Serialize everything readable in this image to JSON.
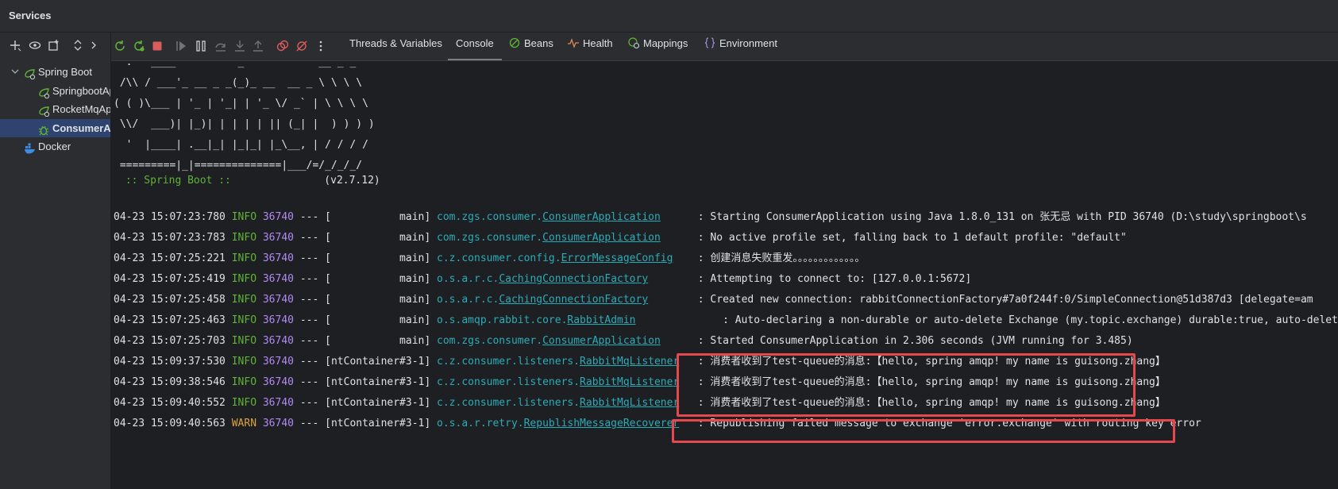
{
  "window": {
    "title": "Services"
  },
  "left_toolbar": {
    "icons": [
      "add-icon",
      "eye-icon",
      "new-window-icon",
      "expand-collapse-icon",
      "chevron-right-icon"
    ]
  },
  "tree": {
    "root": {
      "label": "Spring Boot",
      "icon": "spring-boot-icon"
    },
    "apps": [
      {
        "label": "SpringbootApplication",
        "icon": "spring-app-icon",
        "selected": false
      },
      {
        "label": "RocketMqApplication",
        "icon": "spring-app-icon",
        "selected": false
      },
      {
        "label": "ConsumerApplication",
        "icon": "debug-bug-icon",
        "selected": true
      }
    ],
    "docker": {
      "label": "Docker",
      "icon": "docker-icon"
    }
  },
  "run_toolbar": {
    "icons": [
      "rerun-icon",
      "rerun-debug-icon",
      "stop-icon",
      "resume-icon",
      "pause-icon",
      "step-over-icon",
      "step-into-icon",
      "step-out-icon",
      "view-breakpoints-icon",
      "mute-breakpoints-icon",
      "more-icon"
    ]
  },
  "tabs": [
    {
      "label": "Threads & Variables",
      "icon": "",
      "active": false
    },
    {
      "label": "Console",
      "icon": "",
      "active": true
    },
    {
      "label": "Beans",
      "icon": "beans-icon",
      "active": false
    },
    {
      "label": "Health",
      "icon": "health-icon",
      "active": false
    },
    {
      "label": "Mappings",
      "icon": "mappings-icon",
      "active": false
    },
    {
      "label": "Environment",
      "icon": "environment-icon",
      "active": false
    }
  ],
  "console": {
    "banner_lines": [
      "  .   ____          _            __ _ _",
      " /\\\\ / ___'_ __ _ _(_)_ __  __ _ \\ \\ \\ \\",
      "( ( )\\___ | '_ | '_| | '_ \\/ _` | \\ \\ \\ \\",
      " \\\\/  ___)| |_)| | | | | || (_| |  ) ) ) )",
      "  '  |____| .__|_| |_|_| |_\\__, | / / / /",
      " =========|_|==============|___/=/_/_/_/"
    ],
    "spring_boot_label": " :: Spring Boot :: ",
    "spring_boot_version": "              (v2.7.12)",
    "log_rows": [
      {
        "ts": "04-23 15:07:23:780",
        "level": "INFO",
        "pid": "36740",
        "sep": "---",
        "thread": "[           main]",
        "pkg": "com.zgs.consumer.",
        "cls": "ConsumerApplication",
        "pad": "     ",
        "msg": ": Starting ConsumerApplication using Java 1.8.0_131 on 张无忌 with PID 36740 (D:\\study\\springboot\\s"
      },
      {
        "ts": "04-23 15:07:23:783",
        "level": "INFO",
        "pid": "36740",
        "sep": "---",
        "thread": "[           main]",
        "pkg": "com.zgs.consumer.",
        "cls": "ConsumerApplication",
        "pad": "     ",
        "msg": ": No active profile set, falling back to 1 default profile: \"default\""
      },
      {
        "ts": "04-23 15:07:25:221",
        "level": "INFO",
        "pid": "36740",
        "sep": "---",
        "thread": "[           main]",
        "pkg": "c.z.consumer.config.",
        "cls": "ErrorMessageConfig",
        "pad": "   ",
        "msg": ": 创建消息失败重发。。。。。。。。。。。。。"
      },
      {
        "ts": "04-23 15:07:25:419",
        "level": "INFO",
        "pid": "36740",
        "sep": "---",
        "thread": "[           main]",
        "pkg": "o.s.a.r.c.",
        "cls": "CachingConnectionFactory",
        "pad": "       ",
        "msg": ": Attempting to connect to: [127.0.0.1:5672]"
      },
      {
        "ts": "04-23 15:07:25:458",
        "level": "INFO",
        "pid": "36740",
        "sep": "---",
        "thread": "[           main]",
        "pkg": "o.s.a.r.c.",
        "cls": "CachingConnectionFactory",
        "pad": "       ",
        "msg": ": Created new connection: rabbitConnectionFactory#7a0f244f:0/SimpleConnection@51d387d3 [delegate=am"
      },
      {
        "ts": "04-23 15:07:25:463",
        "level": "INFO",
        "pid": "36740",
        "sep": "---",
        "thread": "[           main]",
        "pkg": "o.s.amqp.rabbit.core.",
        "cls": "RabbitAdmin",
        "pad": "             ",
        "msg": ": Auto-declaring a non-durable or auto-delete Exchange (my.topic.exchange) durable:true, auto-delete"
      },
      {
        "ts": "04-23 15:07:25:703",
        "level": "INFO",
        "pid": "36740",
        "sep": "---",
        "thread": "[           main]",
        "pkg": "com.zgs.consumer.",
        "cls": "ConsumerApplication",
        "pad": "     ",
        "msg": ": Started ConsumerApplication in 2.306 seconds (JVM running for 3.485)"
      },
      {
        "ts": "04-23 15:09:37:530",
        "level": "INFO",
        "pid": "36740",
        "sep": "---",
        "thread": "[ntContainer#3-1]",
        "pkg": "c.z.consumer.listeners.",
        "cls": "RabbitMqListener",
        "pad": "  ",
        "msg": ": 消费者收到了test-queue的消息:【hello, spring amqp! my name is guisong.zhang】"
      },
      {
        "ts": "04-23 15:09:38:546",
        "level": "INFO",
        "pid": "36740",
        "sep": "---",
        "thread": "[ntContainer#3-1]",
        "pkg": "c.z.consumer.listeners.",
        "cls": "RabbitMqListener",
        "pad": "  ",
        "msg": ": 消费者收到了test-queue的消息:【hello, spring amqp! my name is guisong.zhang】"
      },
      {
        "ts": "04-23 15:09:40:552",
        "level": "INFO",
        "pid": "36740",
        "sep": "---",
        "thread": "[ntContainer#3-1]",
        "pkg": "c.z.consumer.listeners.",
        "cls": "RabbitMqListener",
        "pad": "  ",
        "msg": ": 消费者收到了test-queue的消息:【hello, spring amqp! my name is guisong.zhang】"
      },
      {
        "ts": "04-23 15:09:40:563",
        "level": "WARN",
        "pid": "36740",
        "sep": "---",
        "thread": "[ntContainer#3-1]",
        "pkg": "o.s.a.r.retry.",
        "cls": "RepublishMessageRecoverer",
        "pad": "  ",
        "msg": ": Republishing failed message to exchange 'error.exchange' with routing key error"
      }
    ]
  },
  "colors": {
    "info": "#5fb336",
    "warn": "#d9a343",
    "pid": "#b189f5",
    "logger": "#2aacb8",
    "highlight": "#e5484d",
    "selection": "#2e436e"
  }
}
